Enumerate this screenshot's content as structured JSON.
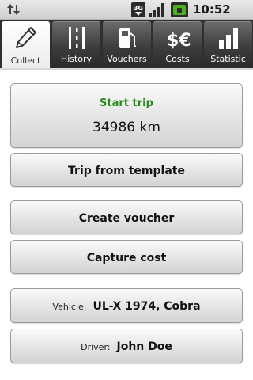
{
  "status_bar": {
    "network_label": "3G",
    "time": "10:52 PM",
    "icons": [
      "sync-arrows-icon",
      "3g-icon",
      "signal-icon",
      "battery-icon"
    ]
  },
  "tabs": [
    {
      "label": "Collect",
      "icon": "pencil-icon",
      "active": true
    },
    {
      "label": "History",
      "icon": "road-icon",
      "active": false
    },
    {
      "label": "Vouchers",
      "icon": "fuel-pump-icon",
      "active": false
    },
    {
      "label": "Costs",
      "icon": "dollar-euro-icon",
      "active": false
    },
    {
      "label": "Statistic",
      "icon": "bar-chart-icon",
      "active": false
    }
  ],
  "main": {
    "start_trip": {
      "label": "Start trip",
      "odometer": "34986 km"
    },
    "trip_from_template": "Trip from template",
    "create_voucher": "Create voucher",
    "capture_cost": "Capture cost",
    "vehicle": {
      "label": "Vehicle:",
      "value": "UL-X 1974, Cobra"
    },
    "driver": {
      "label": "Driver:",
      "value": "John Doe"
    }
  },
  "colors": {
    "accent_green": "#2a8a1e",
    "tabbar_bg": "#2f2f2f",
    "battery_green": "#4caf1e"
  }
}
